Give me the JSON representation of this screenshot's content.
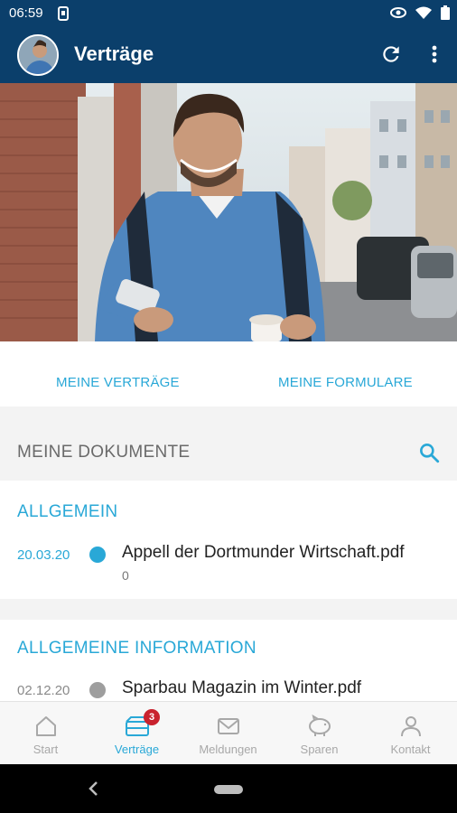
{
  "status_bar": {
    "time": "06:59"
  },
  "app_bar": {
    "title": "Verträge"
  },
  "tabs": [
    {
      "label": "MEINE VERTRÄGE"
    },
    {
      "label": "MEINE FORMULARE"
    }
  ],
  "docs_header": {
    "title": "MEINE DOKUMENTE"
  },
  "sections": [
    {
      "heading": "ALLGEMEIN",
      "items": [
        {
          "date": "20.03.20",
          "name": "Appell der Dortmunder Wirtschaft.pdf",
          "sub": "0",
          "status_color": "#29a8d7"
        }
      ]
    },
    {
      "heading": "ALLGEMEINE INFORMATION",
      "items": [
        {
          "date": "02.12.20",
          "name": "Sparbau Magazin im Winter.pdf",
          "status_color": "#9e9e9e"
        }
      ]
    }
  ],
  "bottom_nav": [
    {
      "label": "Start",
      "icon": "home-icon"
    },
    {
      "label": "Verträge",
      "icon": "contracts-icon",
      "active": true,
      "badge": "3"
    },
    {
      "label": "Meldungen",
      "icon": "mail-icon"
    },
    {
      "label": "Sparen",
      "icon": "piggy-bank-icon"
    },
    {
      "label": "Kontakt",
      "icon": "person-icon"
    }
  ],
  "colors": {
    "primary": "#0b3f6b",
    "accent": "#29a8d7",
    "badge": "#c9222e"
  }
}
